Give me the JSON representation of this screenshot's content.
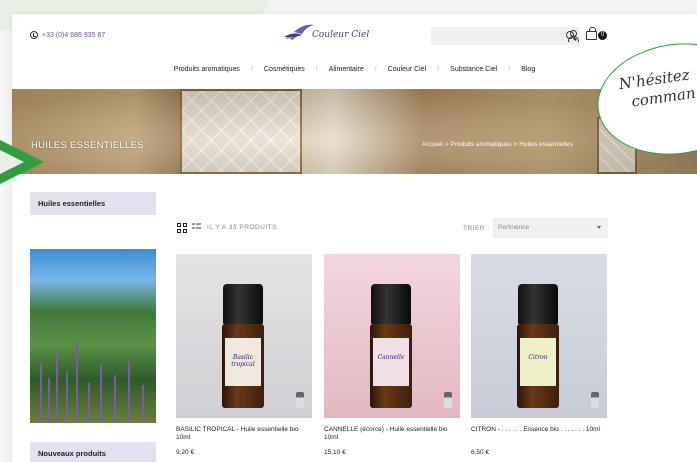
{
  "header": {
    "phone": "+33 (0)4 686 935 67",
    "logo_text": "Couleur Ciel",
    "cart_count": "0"
  },
  "nav": {
    "items": [
      "Produits aromatiques",
      "Cosmétiques",
      "Alimentaire",
      "Couleur Ciel",
      "Substance Ciel",
      "Blog"
    ]
  },
  "banner": {
    "title": "HUILES ESSENTIELLES",
    "breadcrumb": "Accueil > Produits aromatiques > Huiles essentielles"
  },
  "sidebar": {
    "category_title": "Huiles essentielles",
    "new_products_title": "Nouveaux produits"
  },
  "listing": {
    "count_text": "IL Y A 33 PRODUITS.",
    "sort_label": "TRIER :",
    "sort_value": "Pertinence"
  },
  "products": [
    {
      "name": "BASILIC TROPICAL - Huile essentielle bio 10ml",
      "price": "9,20 €",
      "label": "Basilic tropical"
    },
    {
      "name": "CANNELLE (écorce) - Huile essentielle bio 10ml",
      "price": "15,10 €",
      "label": "Cannelle"
    },
    {
      "name": "CITRON - . . . . . . Essence bio . . . . . . . 10ml",
      "price": "6,50 €",
      "label": "Citron"
    }
  ],
  "chat_bubble": {
    "line1": "N'hésitez",
    "line2": "comman"
  },
  "colors": {
    "accent_purple": "#4b3a8a",
    "sidebar_head": "#e1e1ef",
    "bubble_green": "#2e9e3e"
  }
}
